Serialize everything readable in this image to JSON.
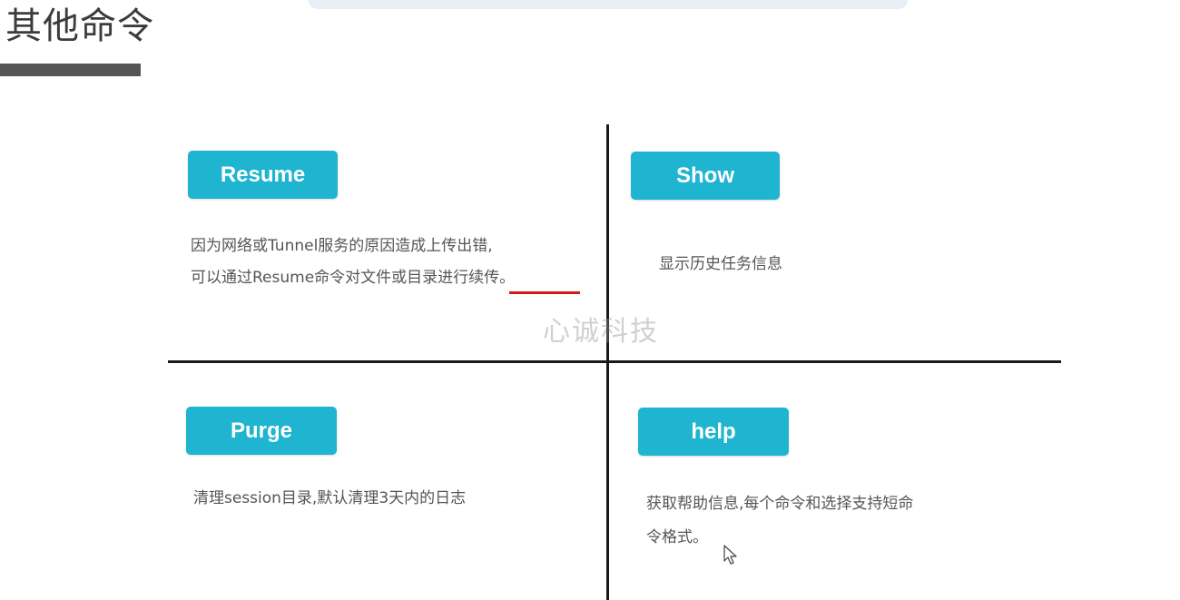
{
  "slide": {
    "title": "其他命令"
  },
  "watermark": "心诚科技",
  "quadrants": {
    "resume": {
      "label": "Resume",
      "line1": "因为网络或Tunnel服务的原因造成上传出错,",
      "line2": "可以通过Resume命令对文件或目录进行续传。"
    },
    "show": {
      "label": "Show",
      "line1": "显示历史任务信息"
    },
    "purge": {
      "label": "Purge",
      "line1": "清理session目录,默认清理3天内的日志"
    },
    "help": {
      "label": "help",
      "line1": "获取帮助信息,每个命令和选择支持短命",
      "line2": "令格式。"
    }
  },
  "colors": {
    "badge": "#1fb4cf",
    "divider": "#1a1a1a",
    "highlight_underline": "#d01c1c",
    "title_bar": "#555555"
  },
  "icons": {
    "cursor": "mouse-pointer-icon"
  }
}
